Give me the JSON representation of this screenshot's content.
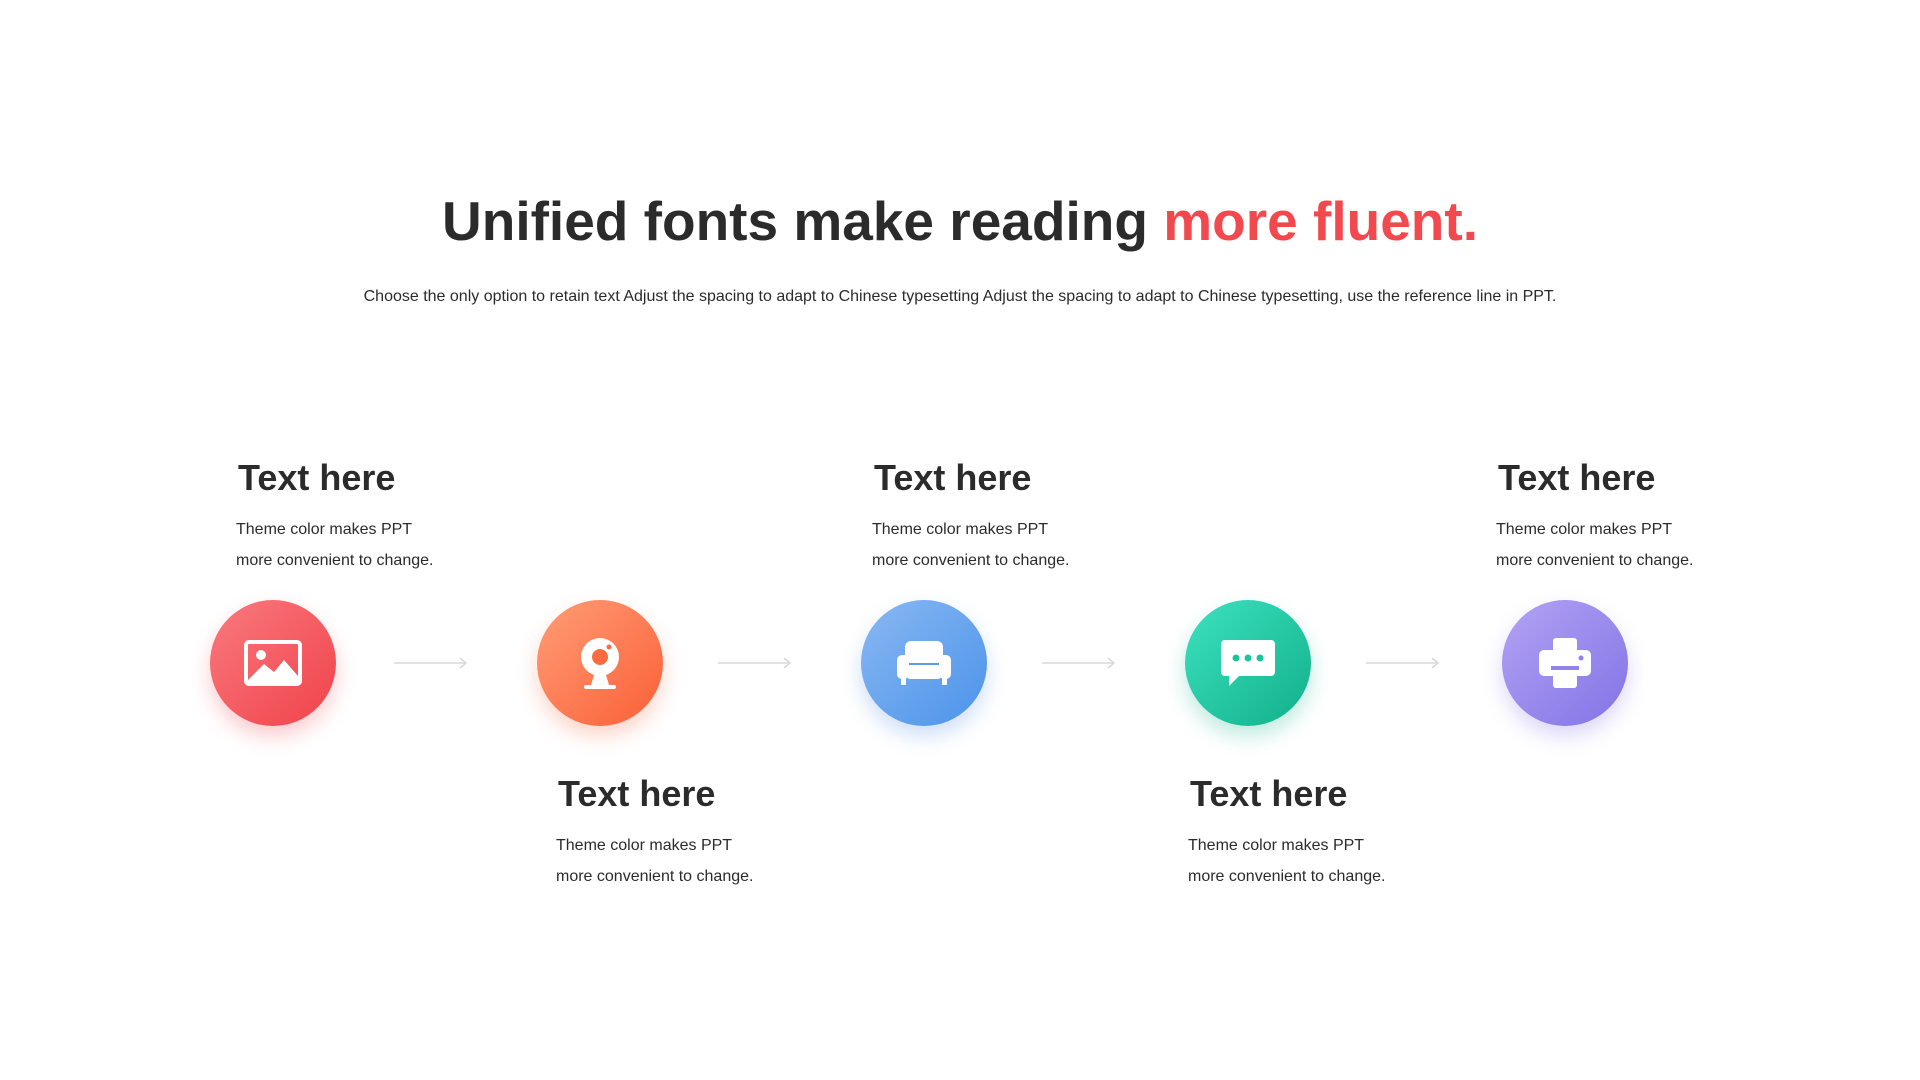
{
  "header": {
    "title_main": "Unified fonts make reading ",
    "title_accent": "more fluent.",
    "subtitle": "Choose the only option to retain text Adjust the spacing to adapt to Chinese typesetting Adjust the spacing to adapt to Chinese typesetting, use the reference line in PPT."
  },
  "colors": {
    "accent": "#f2494e",
    "text": "#2b2b2b",
    "step1": "#f0424a",
    "step2": "#fb5f36",
    "step3": "#4b93e9",
    "step4": "#10b08a",
    "step5": "#8273e6"
  },
  "steps": [
    {
      "icon": "image-icon",
      "heading": "Text here",
      "line1": "Theme color makes PPT",
      "line2": "more convenient to change."
    },
    {
      "icon": "webcam-icon",
      "heading": "Text here",
      "line1": "Theme color makes PPT",
      "line2": "more convenient to change."
    },
    {
      "icon": "sofa-icon",
      "heading": "Text here",
      "line1": "Theme color makes PPT",
      "line2": "more convenient to change."
    },
    {
      "icon": "chat-bubble-icon",
      "heading": "Text here",
      "line1": "Theme color makes PPT",
      "line2": "more convenient to change."
    },
    {
      "icon": "printer-icon",
      "heading": "Text here",
      "line1": "Theme color makes PPT",
      "line2": "more convenient to change."
    }
  ]
}
